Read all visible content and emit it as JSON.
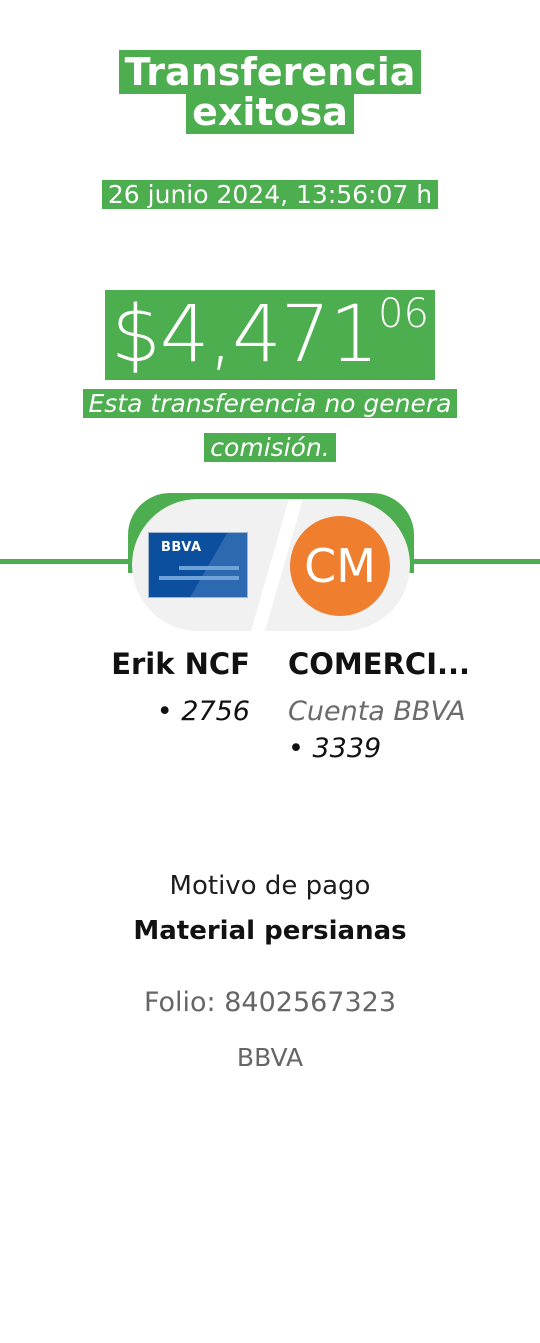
{
  "header": {
    "title_line1": "Transferencia",
    "title_line2": "exitosa",
    "datetime": "26 junio 2024, 13:56:07 h"
  },
  "amount": {
    "whole": "$4,471",
    "cents": "06"
  },
  "fee_note": "Esta transferencia no genera comisión.",
  "sender": {
    "card_brand": "BBVA",
    "name": "Erik NCF",
    "account": "• 2756"
  },
  "recipient": {
    "initials": "CM",
    "name": "COMERCI...",
    "bank": "Cuenta BBVA",
    "account": "• 3339"
  },
  "details": {
    "motivo_label": "Motivo de pago",
    "motivo_value": "Material persianas",
    "folio": "Folio: 8402567323",
    "bank": "BBVA"
  },
  "colors": {
    "accent_green": "#4cae4f",
    "avatar_orange": "#ef7e2e",
    "card_blue": "#0c4f9e"
  }
}
